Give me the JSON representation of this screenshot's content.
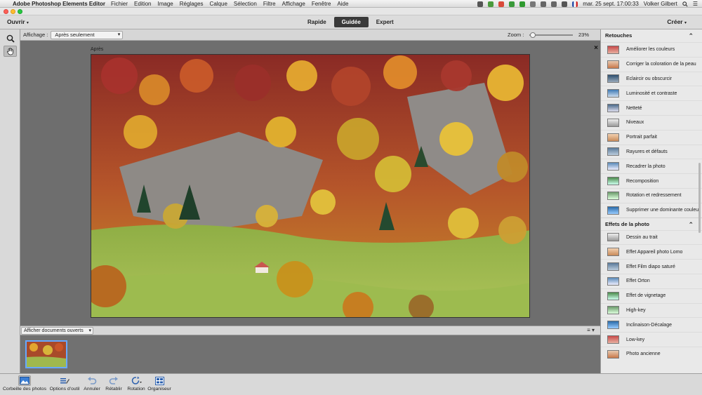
{
  "menubar": {
    "app_name": "Adobe Photoshop Elements Editor",
    "menus": [
      "Fichier",
      "Edition",
      "Image",
      "Réglages",
      "Calque",
      "Sélection",
      "Filtre",
      "Affichage",
      "Fenêtre",
      "Aide"
    ],
    "clock": "mar. 25 sept.  17:00:33",
    "user": "Volker Gilbert"
  },
  "topbar": {
    "open_label": "Ouvrir",
    "modes": [
      "Rapide",
      "Guidée",
      "Expert"
    ],
    "active_mode": "Guidée",
    "create_label": "Créer"
  },
  "options": {
    "view_label": "Affichage :",
    "view_value": "Après seulement",
    "zoom_label": "Zoom :",
    "zoom_value": "23%",
    "zoom_fraction": 0.02
  },
  "canvas": {
    "view_caption": "Après",
    "close_symbol": "×"
  },
  "bin": {
    "select_value": "Afficher documents ouverts"
  },
  "panel": {
    "sections": [
      {
        "title": "Retouches",
        "items": [
          "Améliorer les couleurs",
          "Corriger la coloration de la peau",
          "Eclaircir ou obscurcir",
          "Luminosité et contraste",
          "Netteté",
          "Niveaux",
          "Portrait parfait",
          "Rayures et défauts",
          "Recadrer la photo",
          "Recomposition",
          "Rotation et redressement",
          "Supprimer une dominante couleur"
        ]
      },
      {
        "title": "Effets de la photo",
        "items": [
          "Dessin au trait",
          "Effet Appareil photo Lomo",
          "Effet Film diapo saturé",
          "Effet Orton",
          "Effet de vignetage",
          "High-key",
          "Inclinaison-Décalage",
          "Low-key",
          "Photo ancienne"
        ]
      }
    ]
  },
  "taskbar": {
    "buttons": [
      "Corbeille des photos",
      "Options d'outil",
      "Annuler",
      "Rétablir",
      "Rotation",
      "Organiseur"
    ]
  },
  "colors": {
    "accent_blue": "#67a8ff",
    "active_mode_bg": "#3a3a3a"
  }
}
